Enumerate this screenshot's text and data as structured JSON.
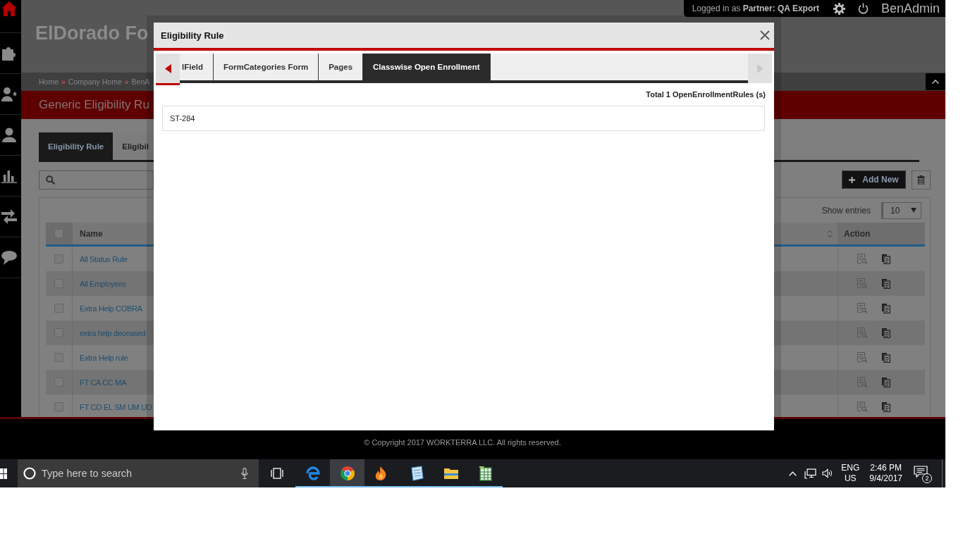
{
  "sidebar": {
    "items": [
      {
        "kind": "home",
        "selected": true
      },
      {
        "kind": "puzzle",
        "selected": false
      },
      {
        "kind": "user-star",
        "selected": false
      },
      {
        "kind": "user",
        "selected": false
      },
      {
        "kind": "chart",
        "selected": false
      },
      {
        "kind": "arrows",
        "selected": false
      },
      {
        "kind": "chat",
        "selected": false
      }
    ]
  },
  "header": {
    "title": "ElDorado Fo",
    "login": "Logged in as **Partner: QA Export**",
    "app_name": "BenAdmin"
  },
  "breadcrumbs": [
    {
      "label": "Home",
      "separator": "»"
    },
    {
      "label": "Company Home",
      "separator": "»"
    },
    {
      "label": "BenA"
    }
  ],
  "page_title": "Generic Eligibility Ru",
  "tabs": [
    {
      "label": "Eligibility Rule",
      "selected": true
    },
    {
      "label": "Eligibil",
      "selected": false
    }
  ],
  "toolbar": {
    "add_button": "Add New"
  },
  "table": {
    "show_entries_label": "Show entries",
    "page_size": "10",
    "select_all": {
      "checked": false
    },
    "columns": [
      "Name",
      "Action"
    ],
    "rows": [
      {
        "name": "All Status Rule",
        "checked": false
      },
      {
        "name": "All Employees",
        "checked": false
      },
      {
        "name": "Extra Help COBRA",
        "checked": false
      },
      {
        "name": "extra help deceased",
        "checked": false
      },
      {
        "name": "Extra Help rule",
        "checked": false
      },
      {
        "name": "FT CA CC MA",
        "checked": false
      },
      {
        "name": "FT CO EL SM UM UD",
        "checked": false
      }
    ]
  },
  "modal": {
    "title": "Eligibility Rule",
    "scroll_buttons": [
      {
        "kind": "left",
        "disabled": false
      },
      {
        "kind": "right",
        "disabled": true
      }
    ],
    "tabs": [
      {
        "label": "lField",
        "selected": false
      },
      {
        "label": "FormCategories Form",
        "selected": false
      },
      {
        "label": "Pages",
        "selected": false
      },
      {
        "label": "Classwise Open Enrollment",
        "selected": true
      }
    ],
    "total": "Total 1 OpenEnrollmentRules (s)",
    "items": [
      "ST-284"
    ]
  },
  "footer": {
    "copyright": "© Copyright 2017 WORKTERRA LLC. All rights reserved."
  },
  "taskbar": {
    "search": {
      "placeholder": "Type here to search"
    },
    "apps": [
      {
        "kind": "swirl",
        "running": true,
        "selected": false
      },
      {
        "kind": "chrome",
        "running": true,
        "selected": true
      },
      {
        "kind": "flame",
        "running": true,
        "selected": false
      },
      {
        "kind": "notepad",
        "running": true,
        "selected": false
      },
      {
        "kind": "folder",
        "running": true,
        "selected": false
      },
      {
        "kind": "spreadsheet",
        "running": true,
        "selected": false
      }
    ],
    "language": "ENG",
    "region": "US",
    "time": "2:46 PM",
    "date": "9/4/2017",
    "notifications": "2"
  }
}
